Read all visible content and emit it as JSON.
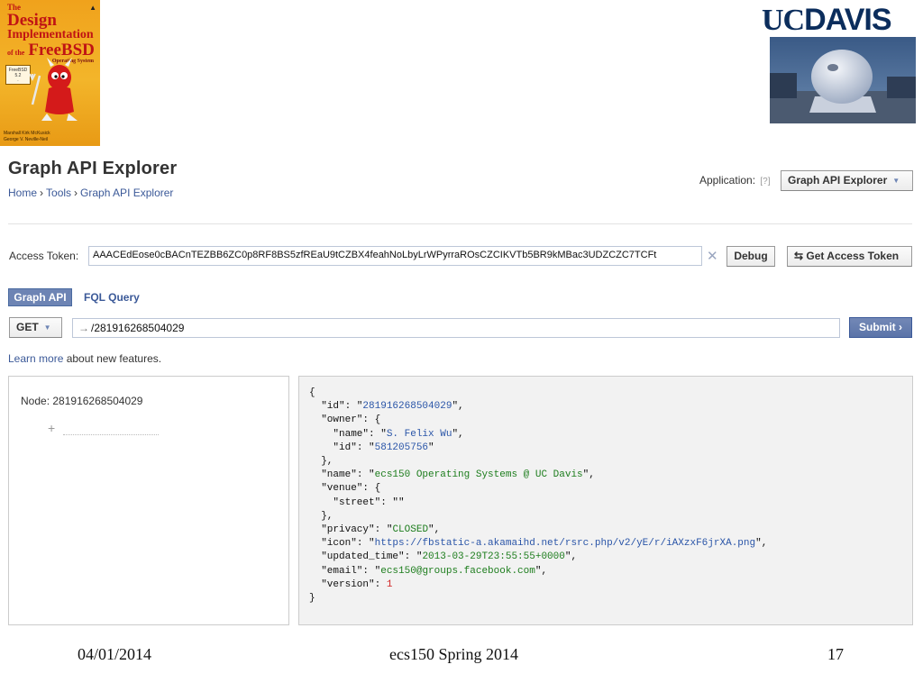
{
  "book": {
    "the": "The",
    "design": "Design",
    "implementation": "Implementation",
    "of_the": "of the",
    "freebsd": "FreeBSD",
    "os": "Operating System",
    "authors": "Marshall Kirk McKusick\nGeorge V. Neville-Neil"
  },
  "logo": {
    "uc": "UC",
    "davis": "DAVIS"
  },
  "header": {
    "title": "Graph API Explorer",
    "breadcrumbs": [
      "Home",
      "Tools",
      "Graph API Explorer"
    ],
    "application_label": "Application:",
    "application_help": "[?]",
    "application_value": "Graph API Explorer"
  },
  "token": {
    "label": "Access Token:",
    "value": "AAACEdEose0cBACnTEZBB6ZC0p8RF8BS5zfREaU9tCZBX4feahNoLbyLrWPyrraROsCZCIKVTb5BR9kMBac3UDZCZC7TCFt",
    "debug_label": "Debug",
    "get_token_label": "⇆ Get Access Token"
  },
  "tabs": {
    "graph": "Graph API",
    "fql": "FQL Query"
  },
  "request": {
    "method": "GET",
    "arrow": "→",
    "path": "/281916268504029",
    "submit_label": "Submit ›"
  },
  "learn": {
    "link": "Learn more",
    "rest": " about new features."
  },
  "node": {
    "label": "Node:",
    "id": "281916268504029",
    "plus": "+"
  },
  "response": {
    "open": "{",
    "close": "}",
    "id": "281916268504029",
    "owner_name": "S. Felix Wu",
    "owner_id": "581205756",
    "name": "ecs150 Operating Systems @ UC Davis",
    "venue_street": "",
    "privacy": "CLOSED",
    "icon": "https://fbstatic-a.akamaihd.net/rsrc.php/v2/yE/r/iAXzxF6jrXA.png",
    "updated_time": "2013-03-29T23:55:55+0000",
    "email": "ecs150@groups.facebook.com",
    "version": "1"
  },
  "footer": {
    "date": "04/01/2014",
    "course": "ecs150 Spring 2014",
    "page": "17"
  },
  "colors": {
    "fb_blue": "#3b5998",
    "tab_blue": "#6d84b4",
    "string_green": "#1d7d1d",
    "number_red": "#d12424"
  }
}
